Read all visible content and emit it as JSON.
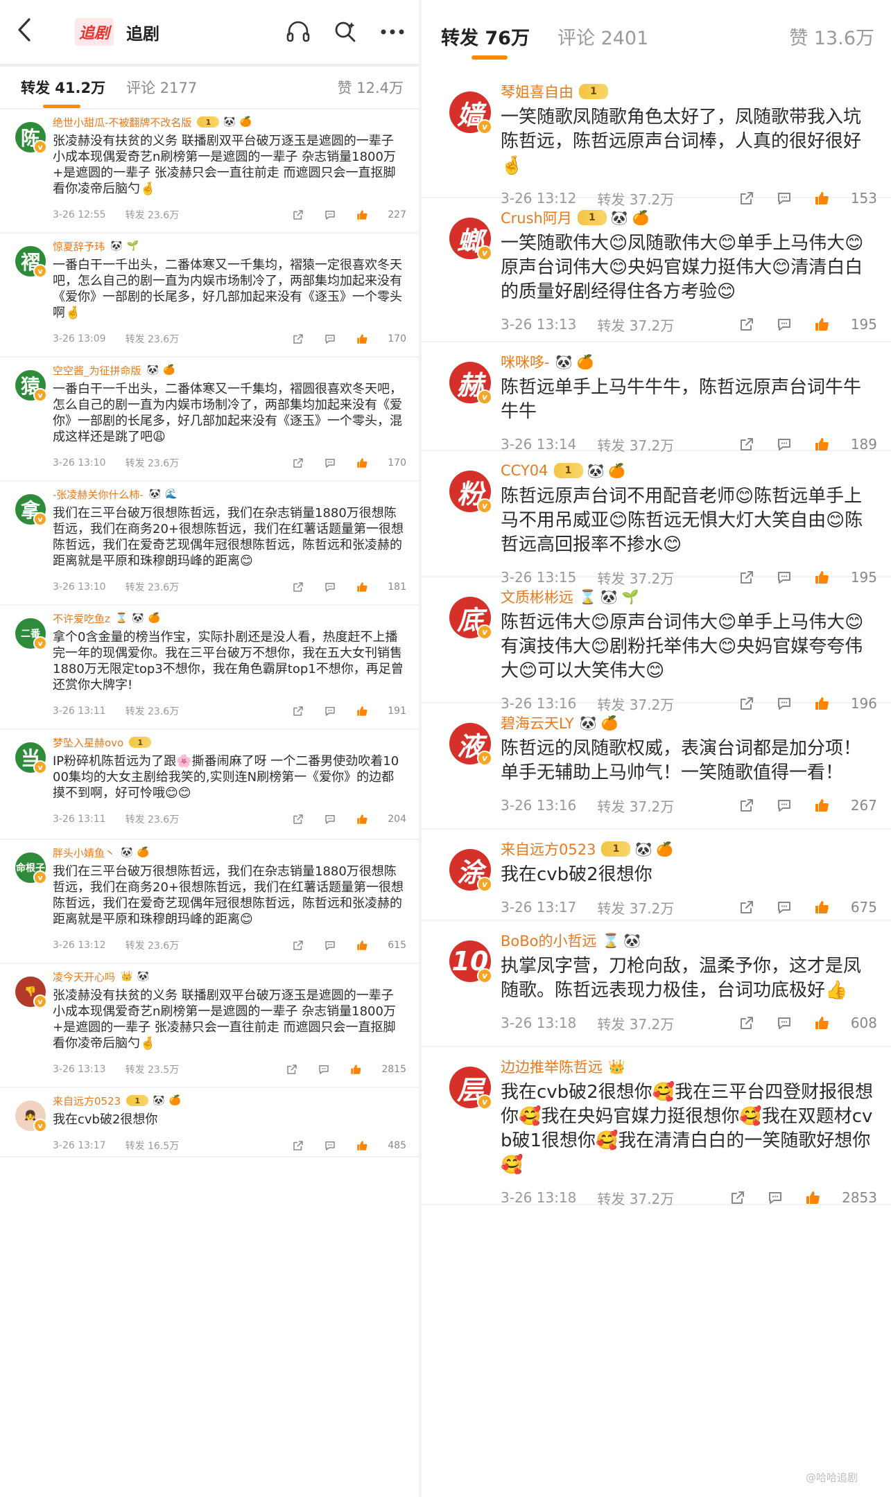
{
  "left": {
    "header": {
      "back_icon": "chevron-left-icon",
      "logo": "追剧",
      "title": "追剧",
      "icons": [
        "listen-icon",
        "search-icon",
        "more-icon"
      ]
    },
    "tabs": [
      {
        "label": "转发 41.2万"
      },
      {
        "label": "评论 2177"
      },
      {
        "label": "赞 12.4万"
      }
    ],
    "comments": [
      {
        "avatar": "陈",
        "avatar_color": "#2e8b3a",
        "user": "绝世小甜瓜-不被翻牌不改名版",
        "badges": [
          "1",
          "🐼",
          "🍊"
        ],
        "text": "张凌赫没有扶贫的义务 联播剧双平台破万逐玉是遮圆的一辈子 小成本现偶爱奇艺n刷榜第一是遮圆的一辈子 杂志销量1800万+是遮圆的一辈子 张凌赫只会一直往前走 而遮圆只会一直抠脚看你凌帝后脑勺🤞",
        "time": "3-26 12:55",
        "forward": "转发 23.6万",
        "likes": "227"
      },
      {
        "avatar": "褶",
        "avatar_color": "#2e8b3a",
        "user": "惊夏辞予玮",
        "badges": [
          "🐼",
          "🌱"
        ],
        "text": "一番白干一千出头，二番体寒又一千集均，褶猿一定很喜欢冬天吧，怎么自己的剧一直为内娱市场制冷了，两部集均加起来没有《爱你》一部剧的长尾多，好几部加起来没有《逐玉》一个零头啊🤞",
        "time": "3-26 13:09",
        "forward": "转发 23.6万",
        "likes": "170"
      },
      {
        "avatar": "猿",
        "avatar_color": "#2e8b3a",
        "user": "空空酱_为征拼命版",
        "badges": [
          "🐼",
          "🍊"
        ],
        "text": "一番白干一千出头，二番体寒又一千集均，褶圆很喜欢冬天吧，怎么自己的剧一直为内娱市场制冷了，两部集均加起来没有《爱你》一部剧的长尾多，好几部加起来没有《逐玉》一个零头，混成这样还是跳了吧😩",
        "time": "3-26 13:10",
        "forward": "转发 23.6万",
        "likes": "170"
      },
      {
        "avatar": "拿",
        "avatar_color": "#2e8b3a",
        "user": "-张凌赫关你什么柿-",
        "badges": [
          "🐼",
          "🌊"
        ],
        "text": "我们在三平台破万很想陈哲远，我们在杂志销量1880万很想陈哲远，我们在商务20+很想陈哲远，我们在红薯话题量第一很想陈哲远，我们在爱奇艺现偶年冠很想陈哲远，陈哲远和张凌赫的距离就是平原和珠穆朗玛峰的距离😊",
        "time": "3-26 13:10",
        "forward": "转发 23.6万",
        "likes": "181"
      },
      {
        "avatar": "二番",
        "avatar_color": "#2e8b3a",
        "user": "不许爱吃鱼z",
        "badges": [
          "⌛",
          "🐼",
          "🍊"
        ],
        "text": "拿个0含金量的榜当作宝，实际扑剧还是没人看，热度赶不上播完一年的现偶爱你。我在三平台破万不想你，我在五大女刊销售1880万无限定top3不想你，我在角色霸屏top1不想你，再足曾还赏你大牌字!",
        "time": "3-26 13:11",
        "forward": "转发 23.6万",
        "likes": "191"
      },
      {
        "avatar": "当",
        "avatar_color": "#2e8b3a",
        "user": "梦坠入星赫ovo",
        "badges": [
          "1"
        ],
        "text": "IP粉碎机陈哲远为了跟🌸撕番闹麻了呀 一个二番男使劲吹着1000集均的大女主剧给我笑的,实则连N刷榜第一《爱你》的边都摸不到啊，好可怜哦😊😊",
        "time": "3-26 13:11",
        "forward": "转发 23.6万",
        "likes": "204"
      },
      {
        "avatar": "命根子",
        "avatar_color": "#2e8b3a",
        "user": "胖头小婧鱼丶",
        "badges": [
          "🐼",
          "🍊"
        ],
        "text": "我们在三平台破万很想陈哲远，我们在杂志销量1880万很想陈哲远，我们在商务20+很想陈哲远，我们在红薯话题量第一很想陈哲远，我们在爱奇艺现偶年冠很想陈哲远，陈哲远和张凌赫的距离就是平原和珠穆朗玛峰的距离😊",
        "time": "3-26 13:12",
        "forward": "转发 23.6万",
        "likes": "615"
      },
      {
        "avatar": "👎",
        "avatar_color": "#b23a2a",
        "user": "凌今天开心吗",
        "badges": [
          "👑",
          "🐼"
        ],
        "text": "张凌赫没有扶贫的义务 联播剧双平台破万逐玉是遮圆的一辈子 小成本现偶爱奇艺n刷榜第一是遮圆的一辈子 杂志销量1800万+是遮圆的一辈子 张凌赫只会一直往前走 而遮圆只会一直抠脚看你凌帝后脑勺🤞",
        "time": "3-26 13:13",
        "forward": "转发 23.5万",
        "likes": "2815"
      },
      {
        "avatar": "👧",
        "avatar_color": "#f2d3c2",
        "user": "来自远方0523",
        "badges": [
          "1",
          "🐼",
          "🍊"
        ],
        "text": "我在cvb破2很想你",
        "time": "3-26 13:17",
        "forward": "转发 16.5万",
        "likes": "485"
      }
    ]
  },
  "right": {
    "tabs": [
      {
        "label": "转发 76万"
      },
      {
        "label": "评论 2401"
      },
      {
        "label": "赞 13.6万"
      }
    ],
    "comments": [
      {
        "avatar": "嫱",
        "avatar_color": "#d6302a",
        "user": "琴姐喜自由",
        "badges": [
          "1"
        ],
        "text": "一笑随歌凤随歌角色太好了，凤随歌带我入坑陈哲远，陈哲远原声台词棒，人真的很好很好🤞",
        "time": "3-26 13:12",
        "forward": "转发 37.2万",
        "likes": "153"
      },
      {
        "avatar": "螂",
        "avatar_color": "#d6302a",
        "user": "Crush阿月",
        "badges": [
          "1",
          "🐼",
          "🍊"
        ],
        "text": "一笑随歌伟大😊凤随歌伟大😊单手上马伟大😊原声台词伟大😊央妈官媒力挺伟大😊清清白白的质量好剧经得住各方考验😊",
        "time": "3-26 13:13",
        "forward": "转发 37.2万",
        "likes": "195"
      },
      {
        "avatar": "赫",
        "avatar_color": "#d6302a",
        "user": "咪咪哆-",
        "badges": [
          "🐼",
          "🍊"
        ],
        "text": "陈哲远单手上马牛牛牛，陈哲远原声台词牛牛牛牛",
        "time": "3-26 13:14",
        "forward": "转发 37.2万",
        "likes": "189"
      },
      {
        "avatar": "粉",
        "avatar_color": "#d6302a",
        "user": "CCY04",
        "badges": [
          "1",
          "🐼",
          "🍊"
        ],
        "text": "陈哲远原声台词不用配音老师😊陈哲远单手上马不用吊威亚😊陈哲远无惧大灯大笑自由😊陈哲远高回报率不掺水😊",
        "time": "3-26 13:15",
        "forward": "转发 37.2万",
        "likes": "195"
      },
      {
        "avatar": "底",
        "avatar_color": "#d6302a",
        "user": "文质彬彬远",
        "badges": [
          "⌛",
          "🐼",
          "🌱"
        ],
        "text": "陈哲远伟大😊原声台词伟大😊单手上马伟大😊有演技伟大😊剧粉托举伟大😊央妈官媒夸夸伟大😊可以大笑伟大😊",
        "time": "3-26 13:16",
        "forward": "转发 37.2万",
        "likes": "196"
      },
      {
        "avatar": "液",
        "avatar_color": "#d6302a",
        "user": "碧海云天LY",
        "badges": [
          "🐼",
          "🍊"
        ],
        "text": "陈哲远的凤随歌权威，表演台词都是加分项！单手无辅助上马帅气！一笑随歌值得一看！",
        "time": "3-26 13:16",
        "forward": "转发 37.2万",
        "likes": "267"
      },
      {
        "avatar": "涂",
        "avatar_color": "#d6302a",
        "user": "来自远方0523",
        "badges": [
          "1",
          "🐼",
          "🍊"
        ],
        "text": "我在cvb破2很想你",
        "time": "3-26 13:17",
        "forward": "转发 37.2万",
        "likes": "675"
      },
      {
        "avatar": "10",
        "avatar_color": "#d6302a",
        "user": "BoBo的小哲远",
        "badges": [
          "⌛",
          "🐼"
        ],
        "text": "执掌凤字营，刀枪向敌，温柔予你，这才是凤随歌。陈哲远表现力极佳，台词功底极好👍",
        "time": "3-26 13:18",
        "forward": "转发 37.2万",
        "likes": "608"
      },
      {
        "avatar": "层",
        "avatar_color": "#d6302a",
        "user": "边边推举陈哲远",
        "badges": [
          "👑"
        ],
        "text": "我在cvb破2很想你🥰我在三平台四登财报很想你🥰我在央妈官媒力挺很想你🥰我在双题材cvb破1很想你🥰我在清清白白的一笑随歌好想你🥰",
        "time": "3-26 13:18",
        "forward": "转发 37.2万",
        "likes": "2853"
      }
    ],
    "watermark": "@哈哈追剧"
  }
}
